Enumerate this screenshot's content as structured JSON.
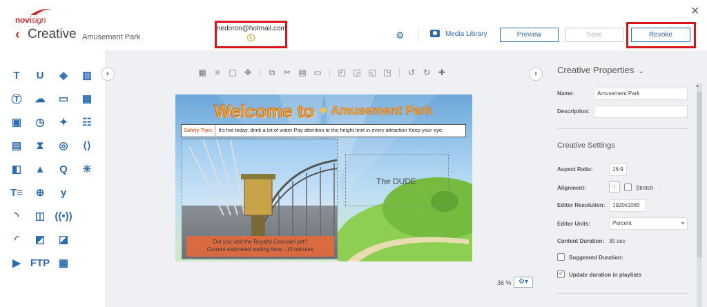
{
  "header": {
    "app_title": "Creative",
    "creative_name": "Amusement Park",
    "user_email": "nirdoron@hotmail.com",
    "media_library_label": "Media Library",
    "preview_label": "Preview",
    "save_label": "Save",
    "revoke_label": "Revoke",
    "close_glyph": "✕",
    "back_glyph": "‹",
    "logo_text": "novi",
    "logo_text_b": "sign"
  },
  "toolbox": {
    "tools": [
      {
        "icon": "text-icon",
        "glyph": "T"
      },
      {
        "icon": "underline-text-icon",
        "glyph": "U"
      },
      {
        "icon": "web-icon",
        "glyph": "◈"
      },
      {
        "icon": "chart-icon",
        "glyph": "▥"
      },
      {
        "icon": "text-box-icon",
        "glyph": "Ⓣ"
      },
      {
        "icon": "weather-icon",
        "glyph": "☁"
      },
      {
        "icon": "tv-icon",
        "glyph": "▭"
      },
      {
        "icon": "table-icon",
        "glyph": "▦"
      },
      {
        "icon": "image-icon",
        "glyph": "▣"
      },
      {
        "icon": "clock-icon",
        "glyph": "◷"
      },
      {
        "icon": "twitter-icon",
        "glyph": "✦"
      },
      {
        "icon": "people-icon",
        "glyph": "☷"
      },
      {
        "icon": "video-icon",
        "glyph": "▤"
      },
      {
        "icon": "hourglass-icon",
        "glyph": "⧗"
      },
      {
        "icon": "instagram-icon",
        "glyph": "◎"
      },
      {
        "icon": "code-icon",
        "glyph": "⟨⟩"
      },
      {
        "icon": "slideshow-icon",
        "glyph": "◧"
      },
      {
        "icon": "shapes-icon",
        "glyph": "▲"
      },
      {
        "icon": "q-icon",
        "glyph": "Q"
      },
      {
        "icon": "loader-icon",
        "glyph": "✳"
      },
      {
        "icon": "text-list-icon",
        "glyph": "T≡"
      },
      {
        "icon": "globe-icon",
        "glyph": "⊕"
      },
      {
        "icon": "yammer-icon",
        "glyph": "y"
      },
      {
        "icon": "empty-slot-icon",
        "glyph": ""
      },
      {
        "icon": "rss-icon",
        "glyph": "◝"
      },
      {
        "icon": "gallery-icon",
        "glyph": "◫"
      },
      {
        "icon": "broadcast-icon",
        "glyph": "((•))"
      },
      {
        "icon": "empty-slot-icon",
        "glyph": ""
      },
      {
        "icon": "rss-feed-icon",
        "glyph": "◜"
      },
      {
        "icon": "image-grid-icon",
        "glyph": "◩"
      },
      {
        "icon": "ad-image-icon",
        "glyph": "◪"
      },
      {
        "icon": "empty-slot-icon",
        "glyph": ""
      },
      {
        "icon": "youtube-icon",
        "glyph": "▶"
      },
      {
        "icon": "ftp-icon",
        "glyph": "FTP"
      },
      {
        "icon": "calendar-icon",
        "glyph": "▦"
      }
    ]
  },
  "editor": {
    "toolbar": [
      {
        "icon": "grid-icon",
        "glyph": "▦"
      },
      {
        "icon": "align-left-icon",
        "glyph": "≡"
      },
      {
        "icon": "fit-icon",
        "glyph": "▢"
      },
      {
        "icon": "move-icon",
        "glyph": "✥"
      },
      {
        "icon": "copy-icon",
        "glyph": "⧉"
      },
      {
        "icon": "cut-icon",
        "glyph": "✂"
      },
      {
        "icon": "paste-icon",
        "glyph": "▤"
      },
      {
        "icon": "delete-icon",
        "glyph": "▭"
      },
      {
        "icon": "bring-front-icon",
        "glyph": "◰"
      },
      {
        "icon": "send-back-icon",
        "glyph": "◲"
      },
      {
        "icon": "bring-forward-icon",
        "glyph": "◱"
      },
      {
        "icon": "send-backward-icon",
        "glyph": "◳"
      },
      {
        "icon": "undo-icon",
        "glyph": "↺"
      },
      {
        "icon": "redo-icon",
        "glyph": "↻"
      },
      {
        "icon": "add-user-icon",
        "glyph": "✚"
      }
    ],
    "banner_welcome": "Welcome to",
    "banner_star": "✦",
    "banner_park": "Amusement Park",
    "ticker_label": "Safety Tips:",
    "ticker_text": "It's hot today, drink a lot of water      Pay attention to the height limit in every attraction      Keep your eye:",
    "caption_line1": "Did you visit the Royalty Carousel yet?",
    "caption_line2": "Current estimated waiting time - 15 minutes",
    "text_widget": "The DUDE",
    "zoom_level": "36 %",
    "zoom_glyph": "⚙▾"
  },
  "properties": {
    "title": "Creative Properties",
    "chevron": "⌄",
    "name_label": "Name:",
    "name_value": "Amusement Park",
    "description_label": "Description:",
    "description_value": "",
    "settings_title": "Creative Settings",
    "aspect_ratio_label": "Aspect Ratio:",
    "aspect_ratio_value": "16:9",
    "alignment_label": "Alignment:",
    "alignment_glyph": "·|·",
    "stretch_label": "Stretch",
    "resolution_label": "Editor Resolution:",
    "resolution_value": "1920x1080",
    "units_label": "Editor Units:",
    "units_value": "Percent",
    "units_caret": "▾",
    "content_duration_label": "Content Duration:",
    "content_duration_value": "30 sec",
    "suggested_duration_label": "Suggested Duration:",
    "update_duration_label": "Update duration in playlists"
  },
  "colors": {
    "accent": "#2d6bb2",
    "brand": "#cc2a2a",
    "highlight": "#d9141a"
  }
}
